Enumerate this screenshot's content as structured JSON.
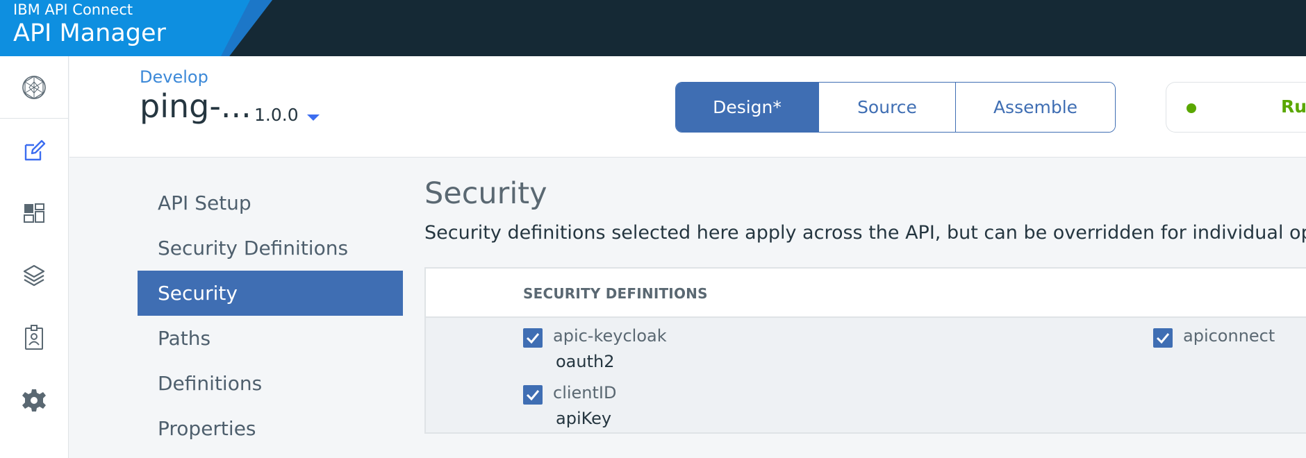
{
  "header": {
    "brand_small": "IBM API Connect",
    "brand_big": "API Manager"
  },
  "rail": {
    "items": [
      {
        "icon": "network-globe-icon"
      },
      {
        "icon": "edit-icon"
      },
      {
        "icon": "dashboard-icon"
      },
      {
        "icon": "layers-icon"
      },
      {
        "icon": "badge-icon"
      },
      {
        "icon": "gear-icon"
      }
    ]
  },
  "api": {
    "breadcrumb": "Develop",
    "name": "ping-...",
    "version": "1.0.0"
  },
  "tabs": [
    {
      "label": "Design*",
      "active": true
    },
    {
      "label": "Source",
      "active": false
    },
    {
      "label": "Assemble",
      "active": false
    }
  ],
  "status": {
    "label": "Run",
    "color": "#5aa700"
  },
  "sidenav": {
    "items": [
      {
        "label": "API Setup",
        "active": false
      },
      {
        "label": "Security Definitions",
        "active": false
      },
      {
        "label": "Security",
        "active": true
      },
      {
        "label": "Paths",
        "active": false
      },
      {
        "label": "Definitions",
        "active": false
      },
      {
        "label": "Properties",
        "active": false
      }
    ]
  },
  "content": {
    "title": "Security",
    "description": "Security definitions selected here apply across the API, but can be overridden for individual opera",
    "table_header": "SECURITY DEFINITIONS",
    "definitions": [
      {
        "name": "apic-keycloak",
        "type": "oauth2",
        "checked": true
      },
      {
        "name": "clientID",
        "type": "apiKey",
        "checked": true
      },
      {
        "name": "apiconnect",
        "type": "",
        "checked": true
      }
    ]
  },
  "colors": {
    "topbar": "#152935",
    "brand": "#0e8fe0",
    "accent": "#3f6eb3",
    "link": "#3c89d8"
  }
}
